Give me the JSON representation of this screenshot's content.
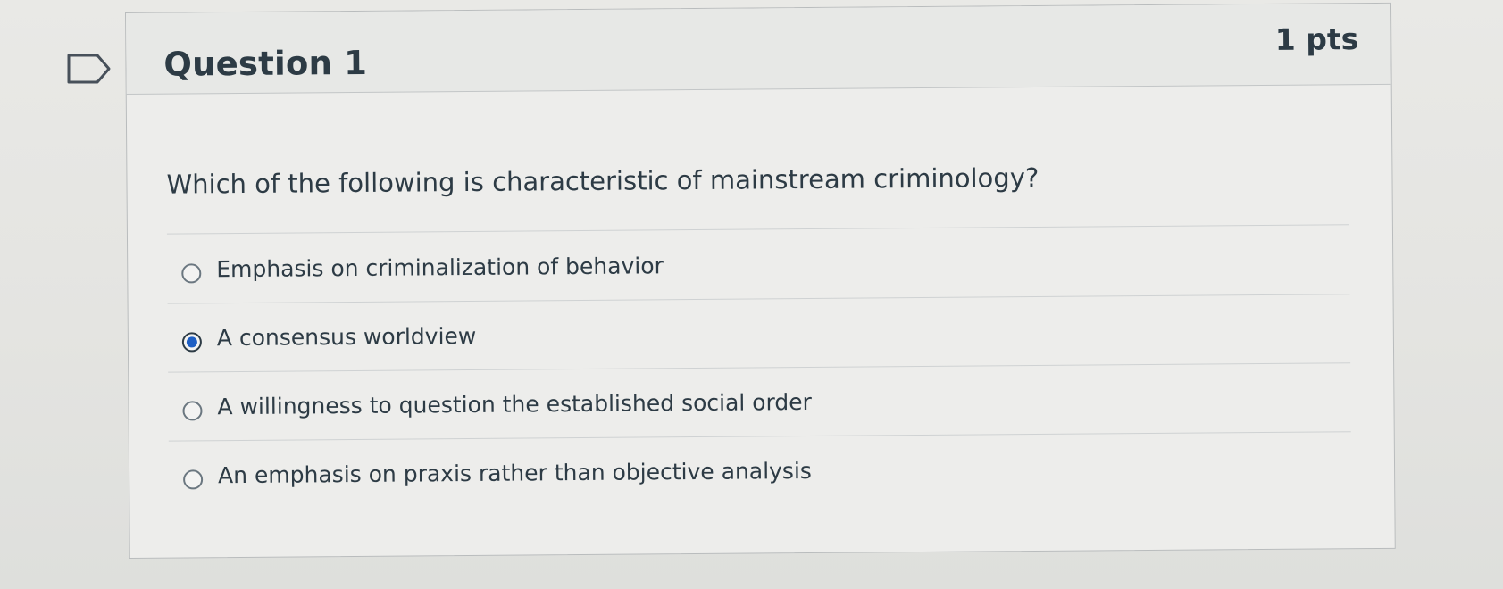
{
  "question": {
    "title": "Question 1",
    "points": "1 pts",
    "text": "Which of the following is characteristic of mainstream criminology?"
  },
  "answers": [
    {
      "label": "Emphasis on criminalization of behavior",
      "selected": false
    },
    {
      "label": "A consensus worldview",
      "selected": true
    },
    {
      "label": "A willingness to question the established social order",
      "selected": false
    },
    {
      "label": "An emphasis on praxis rather than objective analysis",
      "selected": false
    }
  ],
  "icons": {
    "flag": "flag-icon"
  },
  "colors": {
    "selected_radio": "#1e5fc4",
    "text": "#2d3b45"
  }
}
